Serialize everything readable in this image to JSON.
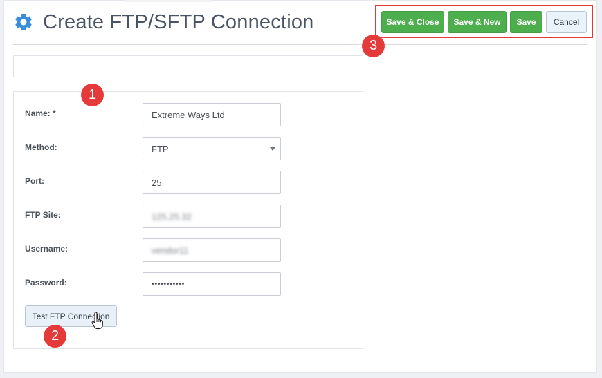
{
  "header": {
    "title": "Create FTP/SFTP Connection",
    "icon": "gear-icon"
  },
  "toolbar": {
    "save_close_label": "Save & Close",
    "save_new_label": "Save & New",
    "save_label": "Save",
    "cancel_label": "Cancel"
  },
  "form": {
    "name": {
      "label": "Name: *",
      "value": "Extreme Ways Ltd"
    },
    "method": {
      "label": "Method:",
      "value": "FTP"
    },
    "port": {
      "label": "Port:",
      "value": "25"
    },
    "ftp_site": {
      "label": "FTP Site:",
      "value": "125.25.32"
    },
    "username": {
      "label": "Username:",
      "value": "vendor11"
    },
    "password": {
      "label": "Password:",
      "value": "•••••••••••"
    },
    "test_button_label": "Test FTP Connection"
  },
  "markers": [
    "1",
    "2",
    "3"
  ],
  "colors": {
    "accent_blue": "#3a8fd8",
    "save_green": "#4cae4c",
    "marker_red": "#e53a3a"
  }
}
